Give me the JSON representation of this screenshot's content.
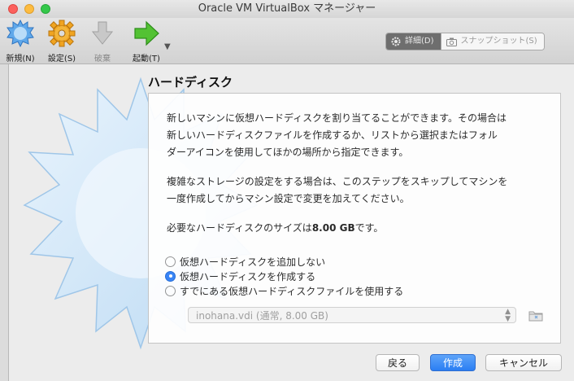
{
  "window": {
    "title": "Oracle VM VirtualBox マネージャー"
  },
  "toolbar": {
    "new_label": "新規(N)",
    "settings_label": "設定(S)",
    "discard_label": "破棄",
    "start_label": "起動(T)",
    "details_label": "詳細(D)",
    "snapshots_label": "スナップショット(S)"
  },
  "dialog": {
    "heading": "ハードディスク",
    "para1_line1": "新しいマシンに仮想ハードディスクを割り当てることができます。その場合は",
    "para1_line2": "新しいハードディスクファイルを作成するか、リストから選択またはフォル",
    "para1_line3": "ダーアイコンを使用してほかの場所から指定できます。",
    "para2_line1": "複雑なストレージの設定をする場合は、このステップをスキップしてマシンを",
    "para2_line2": "一度作成してからマシン設定で変更を加えてください。",
    "size_prefix": "必要なハードディスクのサイズは",
    "size_value": "8.00 GB",
    "size_suffix": "です。",
    "options": [
      {
        "label": "仮想ハードディスクを追加しない",
        "selected": false
      },
      {
        "label": "仮想ハードディスクを作成する",
        "selected": true
      },
      {
        "label": "すでにある仮想ハードディスクファイルを使用する",
        "selected": false
      }
    ],
    "existing_disk_value": "inohana.vdi (通常, 8.00 GB)"
  },
  "buttons": {
    "back": "戻る",
    "create": "作成",
    "cancel": "キャンセル"
  },
  "colors": {
    "accent": "#2a7ef3",
    "radio_selected": "#2d7df6"
  }
}
